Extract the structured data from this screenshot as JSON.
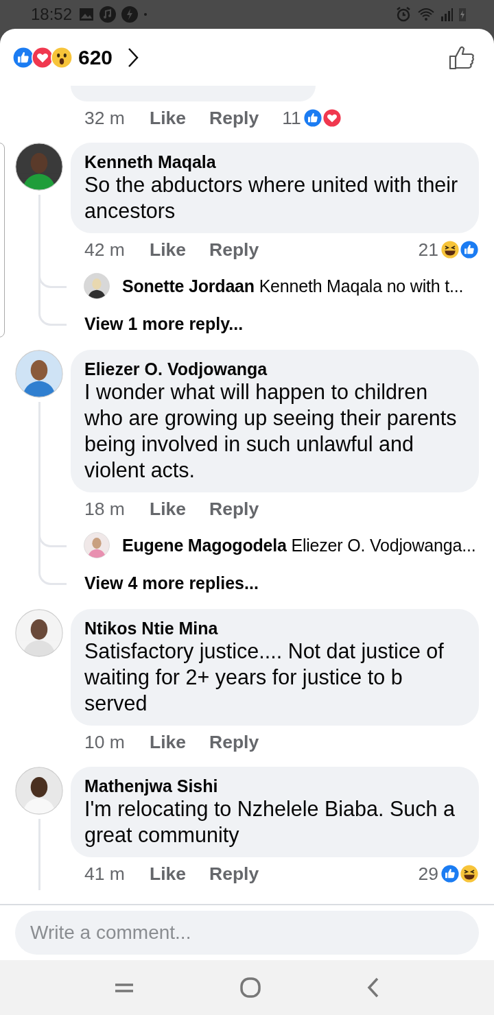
{
  "status_bar": {
    "time": "18:52"
  },
  "header": {
    "reactions": [
      {
        "kind": "like"
      },
      {
        "kind": "love"
      },
      {
        "kind": "wow"
      }
    ],
    "count": "620"
  },
  "top_fragment": {
    "time": "32 m",
    "like": "Like",
    "reply": "Reply",
    "reaction_count": "11",
    "reactions": [
      {
        "kind": "like"
      },
      {
        "kind": "love"
      }
    ]
  },
  "comments": [
    {
      "name": "Kenneth Maqala",
      "text": "So the abductors where united with their ancestors",
      "time": "42 m",
      "like": "Like",
      "reply": "Reply",
      "reaction_count": "21",
      "reactions": [
        {
          "kind": "haha"
        },
        {
          "kind": "like"
        }
      ],
      "thread_line": true,
      "replies": [
        {
          "name": "Sonette Jordaan",
          "text": "Kenneth Maqala no with t..."
        }
      ],
      "more": "View 1 more reply..."
    },
    {
      "name": "Eliezer O. Vodjowanga",
      "text": "I wonder what will happen to children who are growing up seeing their parents being involved in such unlawful and violent acts.",
      "time": "18 m",
      "like": "Like",
      "reply": "Reply",
      "thread_line": true,
      "replies": [
        {
          "name": "Eugene Magogodela",
          "text": "Eliezer O. Vodjowanga..."
        }
      ],
      "more": "View 4 more replies..."
    },
    {
      "name": "Ntikos Ntie Mina",
      "text": "Satisfactory justice.... Not dat justice of waiting for 2+ years for justice to b served",
      "time": "10 m",
      "like": "Like",
      "reply": "Reply",
      "thread_line": false
    },
    {
      "name": "Mathenjwa Sishi",
      "text": "I'm relocating to Nzhelele Biaba. Such a great community",
      "time": "41 m",
      "like": "Like",
      "reply": "Reply",
      "reaction_count": "29",
      "reactions": [
        {
          "kind": "like"
        },
        {
          "kind": "haha"
        }
      ],
      "thread_line": true
    }
  ],
  "composer": {
    "placeholder": "Write a comment..."
  }
}
